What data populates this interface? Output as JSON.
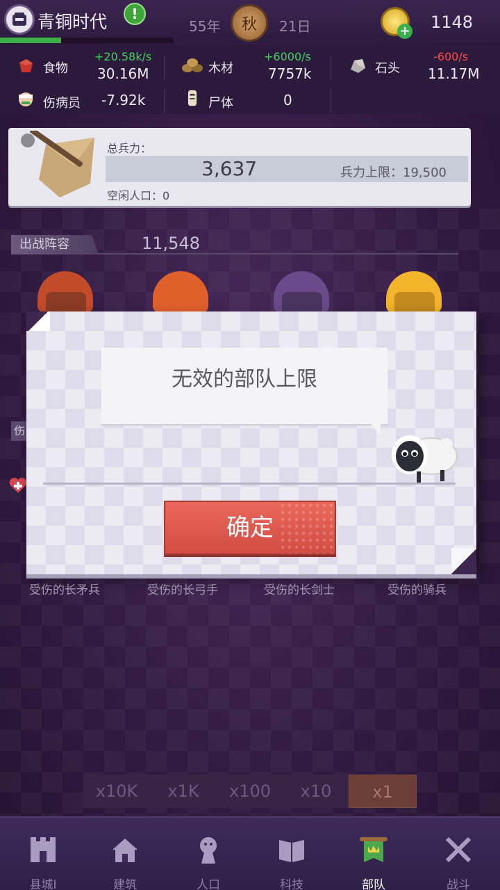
{
  "header": {
    "era_title": "青铜时代",
    "era_progress": 0.35,
    "year": "55年",
    "season": "秋",
    "day": "21日",
    "coins": "1148"
  },
  "resources": {
    "food": {
      "label": "食物",
      "rate": "+20.58k/s",
      "value": "30.16M",
      "icon": "meat-icon"
    },
    "wood": {
      "label": "木材",
      "rate": "+6000/s",
      "value": "7757k",
      "icon": "logs-icon"
    },
    "stone": {
      "label": "石头",
      "rate": "-600/s",
      "value": "11.17M",
      "icon": "stone-icon"
    },
    "wounded": {
      "label": "伤病员",
      "value": "-7.92k",
      "icon": "wounded-icon"
    },
    "corpse": {
      "label": "尸体",
      "value": "0",
      "icon": "corpse-icon"
    }
  },
  "troops": {
    "total_label": "总兵力：",
    "total_value": "3,637",
    "cap_text": "兵力上限：19,500",
    "idle_text": "空闲人口：0"
  },
  "lineup": {
    "label": "出战阵容",
    "power": "11,548",
    "side_tag": "伤"
  },
  "units": [
    {
      "label": "受伤的长矛兵"
    },
    {
      "label": "受伤的长弓手"
    },
    {
      "label": "受伤的长剑士"
    },
    {
      "label": "受伤的骑兵"
    }
  ],
  "multipliers": [
    {
      "label": "x10K",
      "active": false
    },
    {
      "label": "x1K",
      "active": false
    },
    {
      "label": "x100",
      "active": false
    },
    {
      "label": "x10",
      "active": false
    },
    {
      "label": "x1",
      "active": true
    }
  ],
  "nav": [
    {
      "label": "县城I",
      "icon": "castle-icon",
      "active": false
    },
    {
      "label": "建筑",
      "icon": "house-icon",
      "active": false
    },
    {
      "label": "人口",
      "icon": "person-icon",
      "active": false
    },
    {
      "label": "科技",
      "icon": "book-icon",
      "active": false
    },
    {
      "label": "部队",
      "icon": "banner-icon",
      "active": true
    },
    {
      "label": "战斗",
      "icon": "crossed-swords-icon",
      "active": false
    }
  ],
  "dialog": {
    "message": "无效的部队上限",
    "confirm_label": "确定"
  },
  "colors": {
    "accent_red": "#d9534a",
    "positive_green": "#3fd45a",
    "negative_red": "#ff4a4a",
    "background_purple": "#3a2248"
  }
}
